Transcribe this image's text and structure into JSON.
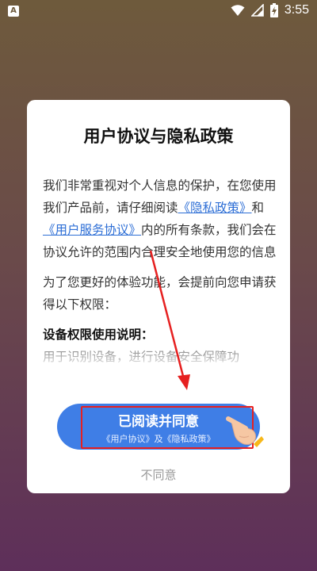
{
  "status_bar": {
    "app_indicator": "A",
    "time": "3:55",
    "icons": [
      "wifi-icon",
      "signal-icon",
      "battery-charging-icon"
    ]
  },
  "dialog": {
    "title": "用户协议与隐私政策",
    "para1": {
      "text_before": "我们非常重视对个人信息的保护，在您使用我们产品前，请仔细阅读",
      "privacy_link": "《隐私政策》",
      "and": "和",
      "service_link": "《用户服务协议》",
      "text_after": "内的所有条款，我们会在协议允许的范围内合理安全地使用您的信息"
    },
    "para2": "为了您更好的体验功能，会提前向您申请获得以下权限：",
    "section_heading": "设备权限使用说明：",
    "faded_text": "用于识别设备，进行设备安全保障功",
    "agree_button": {
      "main_label": "已阅读并同意",
      "sub_label": "《用户协议》及《隐私政策》"
    },
    "disagree_label": "不同意"
  },
  "colors": {
    "accent": "#3f7ee6",
    "link": "#2e6fd6",
    "annotation": "#e62020"
  }
}
